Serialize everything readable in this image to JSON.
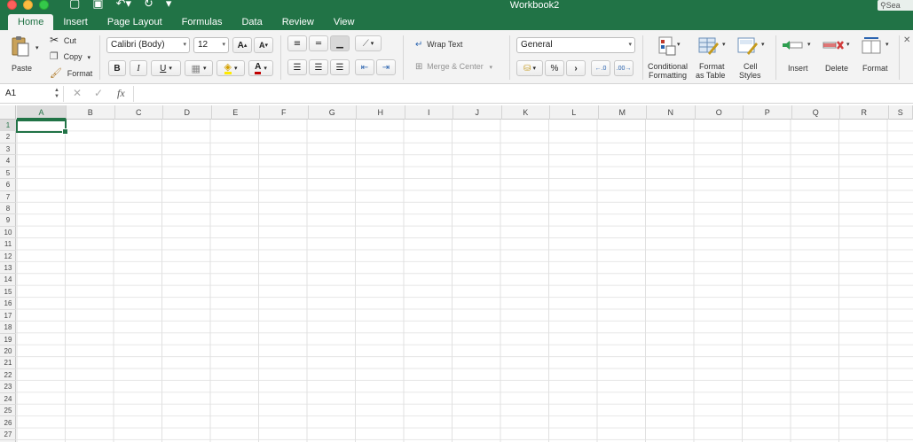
{
  "window": {
    "title": "Workbook2",
    "search_placeholder": "Sea"
  },
  "tabs": [
    "Home",
    "Insert",
    "Page Layout",
    "Formulas",
    "Data",
    "Review",
    "View"
  ],
  "active_tab": "Home",
  "ribbon": {
    "clipboard": {
      "paste": "Paste",
      "cut": "Cut",
      "copy": "Copy",
      "format": "Format"
    },
    "font": {
      "name": "Calibri (Body)",
      "size": "12",
      "bold": "B",
      "italic": "I",
      "underline": "U",
      "grow": "A",
      "shrink": "A",
      "color_letter": "A"
    },
    "alignment": {
      "wrap_text": "Wrap Text",
      "merge_center": "Merge & Center"
    },
    "number": {
      "format": "General",
      "percent": "%",
      "comma": "›",
      "inc_decimal": ".0→.00",
      "dec_decimal": ".00→.0"
    },
    "styles": {
      "conditional_1": "Conditional",
      "conditional_2": "Formatting",
      "format_table_1": "Format",
      "format_table_2": "as Table",
      "cell_styles_1": "Cell",
      "cell_styles_2": "Styles"
    },
    "cells": {
      "insert": "Insert",
      "delete": "Delete",
      "format": "Format"
    }
  },
  "formula_bar": {
    "name_box": "A1",
    "fx": "fx",
    "value": ""
  },
  "grid": {
    "columns": [
      "A",
      "B",
      "C",
      "D",
      "E",
      "F",
      "G",
      "H",
      "I",
      "J",
      "K",
      "L",
      "M",
      "N",
      "O",
      "P",
      "Q",
      "R",
      "S"
    ],
    "rows": [
      "1",
      "2",
      "3",
      "4",
      "5",
      "6",
      "7",
      "8",
      "9",
      "10",
      "11",
      "12",
      "13",
      "14",
      "15",
      "16",
      "17",
      "18",
      "19",
      "20",
      "21",
      "22",
      "23",
      "24",
      "25",
      "26",
      "27"
    ],
    "selected_cell": "A1"
  },
  "colors": {
    "accent": "#217346",
    "ribbon_bg": "#f3f3f3",
    "header_bg": "#f2f2f2"
  }
}
